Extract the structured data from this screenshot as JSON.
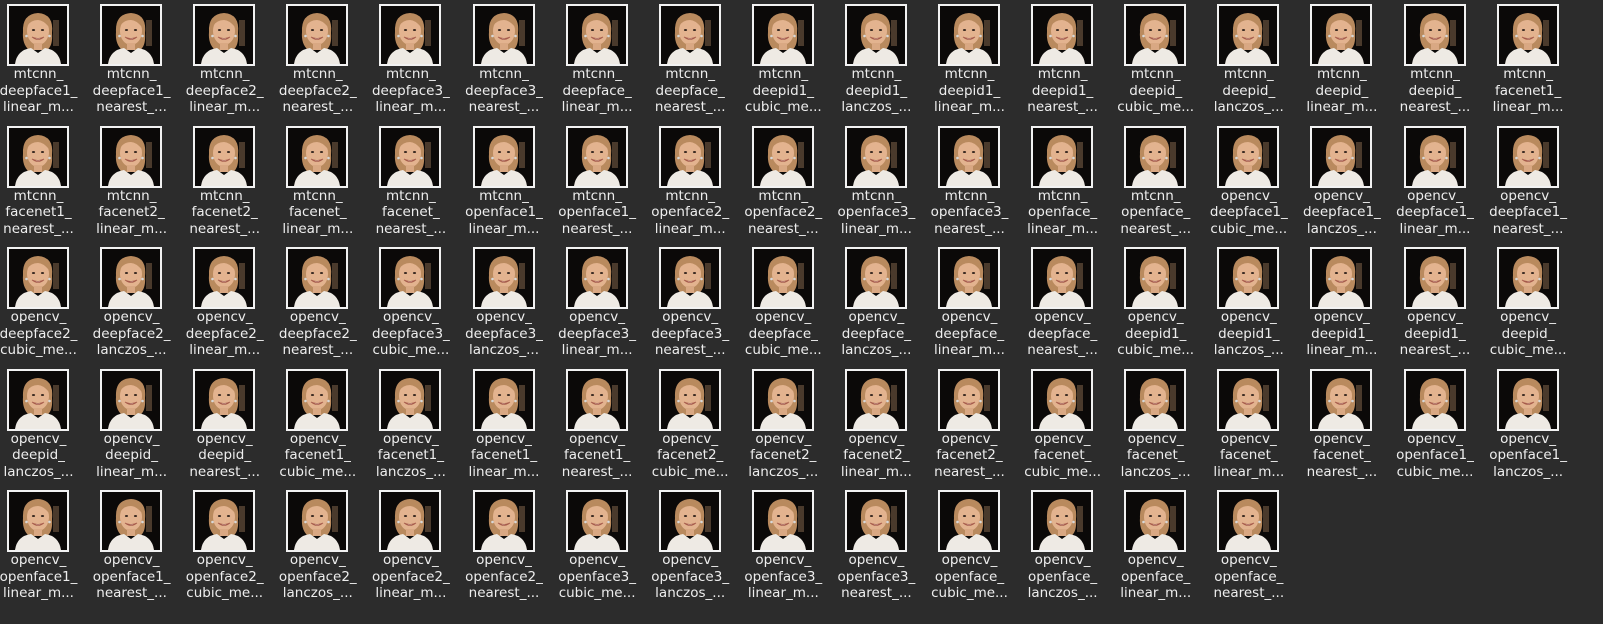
{
  "files": [
    {
      "line1": "mtcnn_",
      "line2": "deepface1_",
      "line3": "linear_m..."
    },
    {
      "line1": "mtcnn_",
      "line2": "deepface1_",
      "line3": "nearest_..."
    },
    {
      "line1": "mtcnn_",
      "line2": "deepface2_",
      "line3": "linear_m..."
    },
    {
      "line1": "mtcnn_",
      "line2": "deepface2_",
      "line3": "nearest_..."
    },
    {
      "line1": "mtcnn_",
      "line2": "deepface3_",
      "line3": "linear_m..."
    },
    {
      "line1": "mtcnn_",
      "line2": "deepface3_",
      "line3": "nearest_..."
    },
    {
      "line1": "mtcnn_",
      "line2": "deepface_",
      "line3": "linear_m..."
    },
    {
      "line1": "mtcnn_",
      "line2": "deepface_",
      "line3": "nearest_..."
    },
    {
      "line1": "mtcnn_",
      "line2": "deepid1_",
      "line3": "cubic_me..."
    },
    {
      "line1": "mtcnn_",
      "line2": "deepid1_",
      "line3": "lanczos_..."
    },
    {
      "line1": "mtcnn_",
      "line2": "deepid1_",
      "line3": "linear_m..."
    },
    {
      "line1": "mtcnn_",
      "line2": "deepid1_",
      "line3": "nearest_..."
    },
    {
      "line1": "mtcnn_",
      "line2": "deepid_",
      "line3": "cubic_me..."
    },
    {
      "line1": "mtcnn_",
      "line2": "deepid_",
      "line3": "lanczos_..."
    },
    {
      "line1": "mtcnn_",
      "line2": "deepid_",
      "line3": "linear_m..."
    },
    {
      "line1": "mtcnn_",
      "line2": "deepid_",
      "line3": "nearest_..."
    },
    {
      "line1": "mtcnn_",
      "line2": "facenet1_",
      "line3": "linear_m..."
    },
    {
      "line1": "mtcnn_",
      "line2": "facenet1_",
      "line3": "nearest_..."
    },
    {
      "line1": "mtcnn_",
      "line2": "facenet2_",
      "line3": "linear_m..."
    },
    {
      "line1": "mtcnn_",
      "line2": "facenet2_",
      "line3": "nearest_..."
    },
    {
      "line1": "mtcnn_",
      "line2": "facenet_",
      "line3": "linear_m..."
    },
    {
      "line1": "mtcnn_",
      "line2": "facenet_",
      "line3": "nearest_..."
    },
    {
      "line1": "mtcnn_",
      "line2": "openface1_",
      "line3": "linear_m..."
    },
    {
      "line1": "mtcnn_",
      "line2": "openface1_",
      "line3": "nearest_..."
    },
    {
      "line1": "mtcnn_",
      "line2": "openface2_",
      "line3": "linear_m..."
    },
    {
      "line1": "mtcnn_",
      "line2": "openface2_",
      "line3": "nearest_..."
    },
    {
      "line1": "mtcnn_",
      "line2": "openface3_",
      "line3": "linear_m..."
    },
    {
      "line1": "mtcnn_",
      "line2": "openface3_",
      "line3": "nearest_..."
    },
    {
      "line1": "mtcnn_",
      "line2": "openface_",
      "line3": "linear_m..."
    },
    {
      "line1": "mtcnn_",
      "line2": "openface_",
      "line3": "nearest_..."
    },
    {
      "line1": "opencv_",
      "line2": "deepface1_",
      "line3": "cubic_me..."
    },
    {
      "line1": "opencv_",
      "line2": "deepface1_",
      "line3": "lanczos_..."
    },
    {
      "line1": "opencv_",
      "line2": "deepface1_",
      "line3": "linear_m..."
    },
    {
      "line1": "opencv_",
      "line2": "deepface1_",
      "line3": "nearest_..."
    },
    {
      "line1": "opencv_",
      "line2": "deepface2_",
      "line3": "cubic_me..."
    },
    {
      "line1": "opencv_",
      "line2": "deepface2_",
      "line3": "lanczos_..."
    },
    {
      "line1": "opencv_",
      "line2": "deepface2_",
      "line3": "linear_m..."
    },
    {
      "line1": "opencv_",
      "line2": "deepface2_",
      "line3": "nearest_..."
    },
    {
      "line1": "opencv_",
      "line2": "deepface3_",
      "line3": "cubic_me..."
    },
    {
      "line1": "opencv_",
      "line2": "deepface3_",
      "line3": "lanczos_..."
    },
    {
      "line1": "opencv_",
      "line2": "deepface3_",
      "line3": "linear_m..."
    },
    {
      "line1": "opencv_",
      "line2": "deepface3_",
      "line3": "nearest_..."
    },
    {
      "line1": "opencv_",
      "line2": "deepface_",
      "line3": "cubic_me..."
    },
    {
      "line1": "opencv_",
      "line2": "deepface_",
      "line3": "lanczos_..."
    },
    {
      "line1": "opencv_",
      "line2": "deepface_",
      "line3": "linear_m..."
    },
    {
      "line1": "opencv_",
      "line2": "deepface_",
      "line3": "nearest_..."
    },
    {
      "line1": "opencv_",
      "line2": "deepid1_",
      "line3": "cubic_me..."
    },
    {
      "line1": "opencv_",
      "line2": "deepid1_",
      "line3": "lanczos_..."
    },
    {
      "line1": "opencv_",
      "line2": "deepid1_",
      "line3": "linear_m..."
    },
    {
      "line1": "opencv_",
      "line2": "deepid1_",
      "line3": "nearest_..."
    },
    {
      "line1": "opencv_",
      "line2": "deepid_",
      "line3": "cubic_me..."
    },
    {
      "line1": "opencv_",
      "line2": "deepid_",
      "line3": "lanczos_..."
    },
    {
      "line1": "opencv_",
      "line2": "deepid_",
      "line3": "linear_m..."
    },
    {
      "line1": "opencv_",
      "line2": "deepid_",
      "line3": "nearest_..."
    },
    {
      "line1": "opencv_",
      "line2": "facenet1_",
      "line3": "cubic_me..."
    },
    {
      "line1": "opencv_",
      "line2": "facenet1_",
      "line3": "lanczos_..."
    },
    {
      "line1": "opencv_",
      "line2": "facenet1_",
      "line3": "linear_m..."
    },
    {
      "line1": "opencv_",
      "line2": "facenet1_",
      "line3": "nearest_..."
    },
    {
      "line1": "opencv_",
      "line2": "facenet2_",
      "line3": "cubic_me..."
    },
    {
      "line1": "opencv_",
      "line2": "facenet2_",
      "line3": "lanczos_..."
    },
    {
      "line1": "opencv_",
      "line2": "facenet2_",
      "line3": "linear_m..."
    },
    {
      "line1": "opencv_",
      "line2": "facenet2_",
      "line3": "nearest_..."
    },
    {
      "line1": "opencv_",
      "line2": "facenet_",
      "line3": "cubic_me..."
    },
    {
      "line1": "opencv_",
      "line2": "facenet_",
      "line3": "lanczos_..."
    },
    {
      "line1": "opencv_",
      "line2": "facenet_",
      "line3": "linear_m..."
    },
    {
      "line1": "opencv_",
      "line2": "facenet_",
      "line3": "nearest_..."
    },
    {
      "line1": "opencv_",
      "line2": "openface1_",
      "line3": "cubic_me..."
    },
    {
      "line1": "opencv_",
      "line2": "openface1_",
      "line3": "lanczos_..."
    },
    {
      "line1": "opencv_",
      "line2": "openface1_",
      "line3": "linear_m..."
    },
    {
      "line1": "opencv_",
      "line2": "openface1_",
      "line3": "nearest_..."
    },
    {
      "line1": "opencv_",
      "line2": "openface2_",
      "line3": "cubic_me..."
    },
    {
      "line1": "opencv_",
      "line2": "openface2_",
      "line3": "lanczos_..."
    },
    {
      "line1": "opencv_",
      "line2": "openface2_",
      "line3": "linear_m..."
    },
    {
      "line1": "opencv_",
      "line2": "openface2_",
      "line3": "nearest_..."
    },
    {
      "line1": "opencv_",
      "line2": "openface3_",
      "line3": "cubic_me..."
    },
    {
      "line1": "opencv_",
      "line2": "openface3_",
      "line3": "lanczos_..."
    },
    {
      "line1": "opencv_",
      "line2": "openface3_",
      "line3": "linear_m..."
    },
    {
      "line1": "opencv_",
      "line2": "openface3_",
      "line3": "nearest_..."
    },
    {
      "line1": "opencv_",
      "line2": "openface_",
      "line3": "cubic_me..."
    },
    {
      "line1": "opencv_",
      "line2": "openface_",
      "line3": "lanczos_..."
    },
    {
      "line1": "opencv_",
      "line2": "openface_",
      "line3": "linear_m..."
    },
    {
      "line1": "opencv_",
      "line2": "openface_",
      "line3": "nearest_..."
    }
  ],
  "thumbnail": {
    "icon": "portrait-thumbnail-icon",
    "frame_color": "#f2f2f2",
    "background_color": "#0b0908",
    "skin_color": "#e3b38f",
    "hair_color": "#b98a5e",
    "clothing_color": "#eeeae4"
  }
}
